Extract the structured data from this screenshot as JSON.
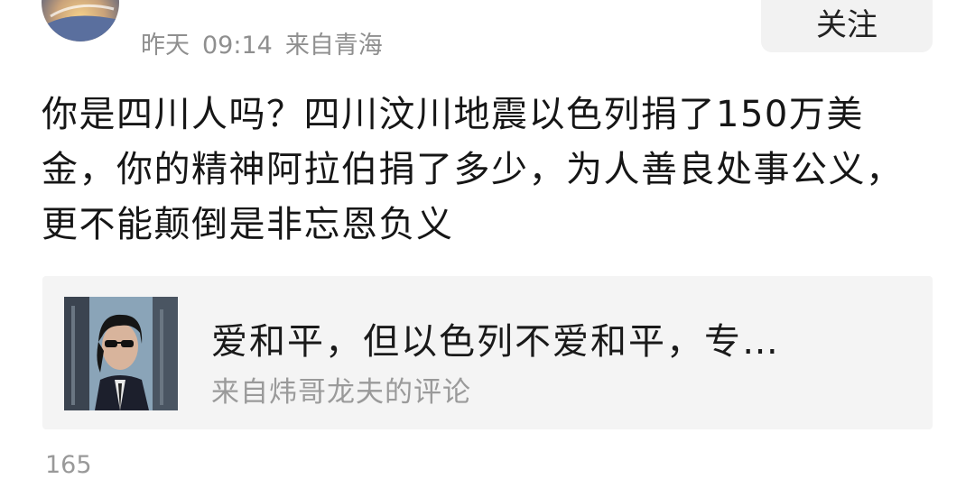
{
  "post": {
    "author": "",
    "date_label": "昨天",
    "time": "09:14",
    "source": "来自青海",
    "follow_label": "关注",
    "text": "你是四川人吗？四川汶川地震以色列捐了150万美金，你的精神阿拉伯捐了多少，为人善良处事公义，更不能颠倒是非忘恩负义"
  },
  "quote": {
    "title": "爱和平，但以色列不爱和平，专…",
    "source": "来自炜哥龙夫的评论"
  },
  "stats": {
    "views_partial": "165",
    "reads_partial": ""
  }
}
